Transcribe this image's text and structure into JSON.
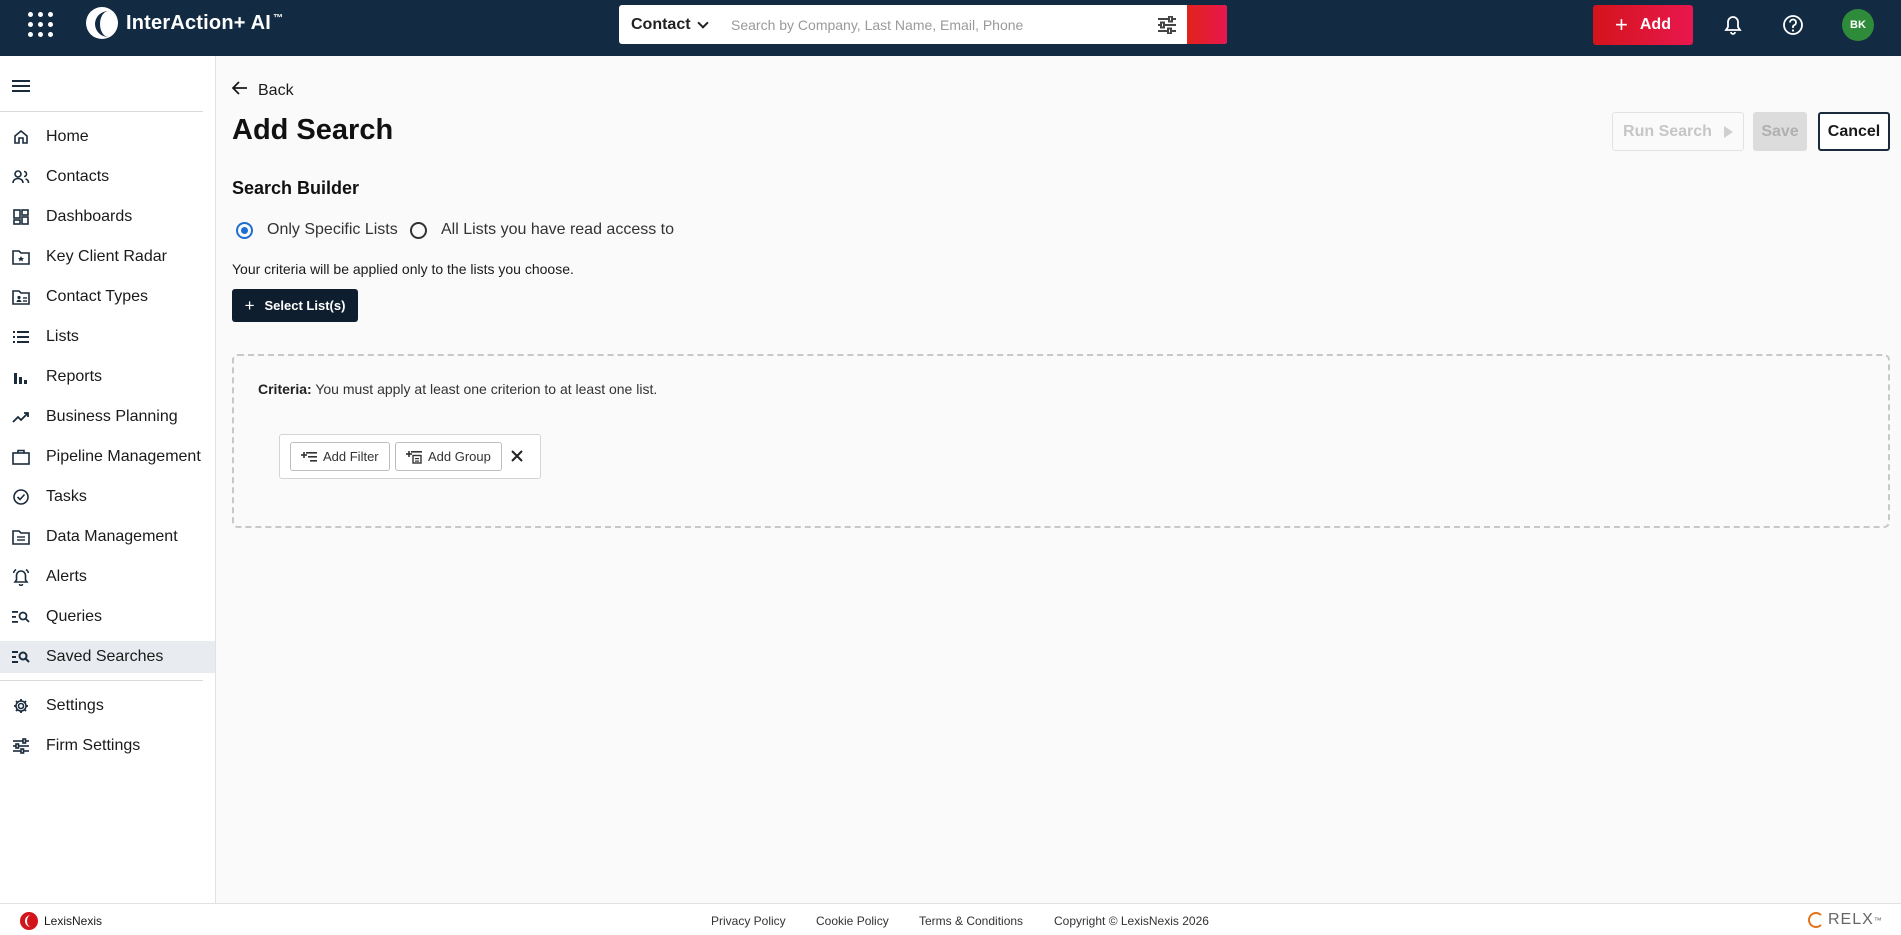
{
  "app": {
    "name": "InterAction+ AI",
    "trademark": "™"
  },
  "search": {
    "type": "Contact",
    "placeholder": "Search by Company, Last Name, Email, Phone"
  },
  "header": {
    "add_label": "Add",
    "avatar_initials": "BK"
  },
  "sidebar": {
    "items": [
      {
        "label": "Home",
        "icon": "home-icon"
      },
      {
        "label": "Contacts",
        "icon": "contacts-icon"
      },
      {
        "label": "Dashboards",
        "icon": "dashboard-icon"
      },
      {
        "label": "Key Client Radar",
        "icon": "radar-folder-icon"
      },
      {
        "label": "Contact Types",
        "icon": "contact-types-icon"
      },
      {
        "label": "Lists",
        "icon": "list-icon"
      },
      {
        "label": "Reports",
        "icon": "bar-chart-icon"
      },
      {
        "label": "Business Planning",
        "icon": "trending-icon"
      },
      {
        "label": "Pipeline Management",
        "icon": "briefcase-icon"
      },
      {
        "label": "Tasks",
        "icon": "check-circle-icon"
      },
      {
        "label": "Data Management",
        "icon": "folder-icon"
      },
      {
        "label": "Alerts",
        "icon": "alarm-icon"
      },
      {
        "label": "Queries",
        "icon": "query-icon"
      },
      {
        "label": "Saved Searches",
        "icon": "saved-search-icon",
        "active": true
      },
      {
        "label": "Settings",
        "icon": "gear-icon"
      },
      {
        "label": "Firm Settings",
        "icon": "sliders-icon"
      }
    ]
  },
  "page": {
    "back_label": "Back",
    "title": "Add Search",
    "run_search_label": "Run Search",
    "save_label": "Save",
    "cancel_label": "Cancel",
    "section_title": "Search Builder",
    "radio_specific": "Only Specific Lists",
    "radio_all": "All Lists you have read access to",
    "radio_selected": "Only Specific Lists",
    "hint": "Your criteria will be applied only to the lists you choose.",
    "select_lists_label": "Select List(s)",
    "criteria_label": "Criteria:",
    "criteria_text": "You must apply at least one criterion to at least one list.",
    "add_filter_label": "Add Filter",
    "add_group_label": "Add Group"
  },
  "footer": {
    "brand": "LexisNexis",
    "privacy": "Privacy Policy",
    "cookie": "Cookie Policy",
    "terms": "Terms & Conditions",
    "copyright": "Copyright © LexisNexis 2026",
    "relx": "RELX",
    "relx_tm": "™"
  },
  "colors": {
    "topbar": "#132a43",
    "accent_red": "#e0231b",
    "radio_blue": "#1d6fd1",
    "avatar_green": "#2e8b3a"
  }
}
